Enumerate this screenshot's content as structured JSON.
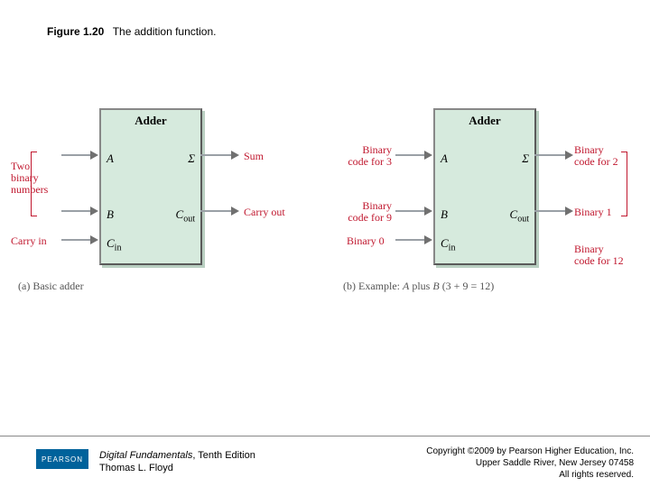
{
  "figure": {
    "number": "Figure 1.20",
    "caption": "The addition function."
  },
  "adders": {
    "left": {
      "title": "Adder",
      "ports": {
        "A": "A",
        "B": "B",
        "Cin": "Cin",
        "Sigma": "Σ",
        "Cout": "Cout"
      },
      "in_labels": {
        "two_binary": "Two\nbinary\nnumbers",
        "carry_in": "Carry in"
      },
      "out_labels": {
        "sum": "Sum",
        "carry_out": "Carry out"
      },
      "caption": "(a) Basic adder"
    },
    "right": {
      "title": "Adder",
      "ports": {
        "A": "A",
        "B": "B",
        "Cin": "Cin",
        "Sigma": "Σ",
        "Cout": "Cout"
      },
      "in_labels": {
        "code3": "Binary\ncode for 3",
        "code9": "Binary\ncode for 9",
        "bin0": "Binary 0"
      },
      "out_labels": {
        "code2": "Binary\ncode for 2",
        "bin1": "Binary 1",
        "code12": "Binary\ncode for 12"
      },
      "caption": "(b) Example: A plus B (3 + 9 = 12)"
    }
  },
  "footer": {
    "publisher": "PEARSON",
    "book_title": "Digital Fundamentals",
    "book_edition": ", Tenth Edition",
    "author": "Thomas L. Floyd",
    "copyright_line1": "Copyright ©2009 by Pearson Higher Education, Inc.",
    "copyright_line2": "Upper Saddle River, New Jersey 07458",
    "copyright_line3": "All rights reserved."
  }
}
